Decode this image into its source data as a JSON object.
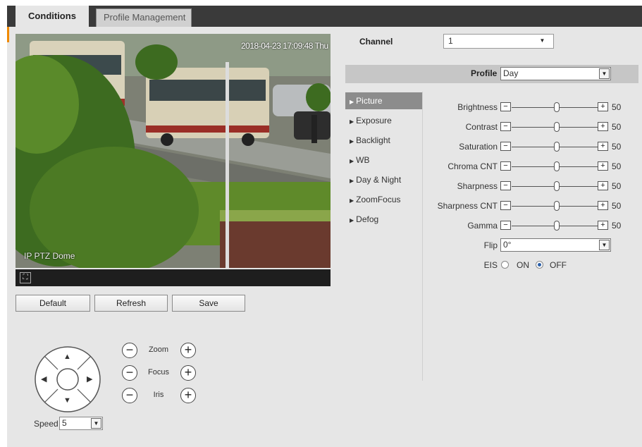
{
  "tabs": [
    {
      "label": "Conditions",
      "active": true
    },
    {
      "label": "Profile Management",
      "active": false
    }
  ],
  "video": {
    "osd_time": "2018-04-23 17:09:48 Thu",
    "osd_name": "IP PTZ Dome"
  },
  "buttons": {
    "default": "Default",
    "refresh": "Refresh",
    "save": "Save"
  },
  "ptz": {
    "zoom_label": "Zoom",
    "focus_label": "Focus",
    "iris_label": "Iris",
    "speed_label": "Speed",
    "speed_value": "5"
  },
  "channel": {
    "label": "Channel",
    "value": "1"
  },
  "profile": {
    "label": "Profile",
    "value": "Day"
  },
  "menu": [
    {
      "label": "Picture",
      "active": true
    },
    {
      "label": "Exposure",
      "active": false
    },
    {
      "label": "Backlight",
      "active": false
    },
    {
      "label": "WB",
      "active": false
    },
    {
      "label": "Day & Night",
      "active": false
    },
    {
      "label": "ZoomFocus",
      "active": false
    },
    {
      "label": "Defog",
      "active": false
    }
  ],
  "sliders": [
    {
      "label": "Brightness",
      "value": "50"
    },
    {
      "label": "Contrast",
      "value": "50"
    },
    {
      "label": "Saturation",
      "value": "50"
    },
    {
      "label": "Chroma CNT",
      "value": "50"
    },
    {
      "label": "Sharpness",
      "value": "50"
    },
    {
      "label": "Sharpness CNT",
      "value": "50"
    },
    {
      "label": "Gamma",
      "value": "50"
    }
  ],
  "flip": {
    "label": "Flip",
    "value": "0°"
  },
  "eis": {
    "label": "EIS",
    "on_label": "ON",
    "off_label": "OFF",
    "selected": "OFF"
  },
  "colors": {
    "active_menu": "#8c8c8c",
    "tab_bar": "#3a3a3a",
    "accent": "#f08a00"
  }
}
